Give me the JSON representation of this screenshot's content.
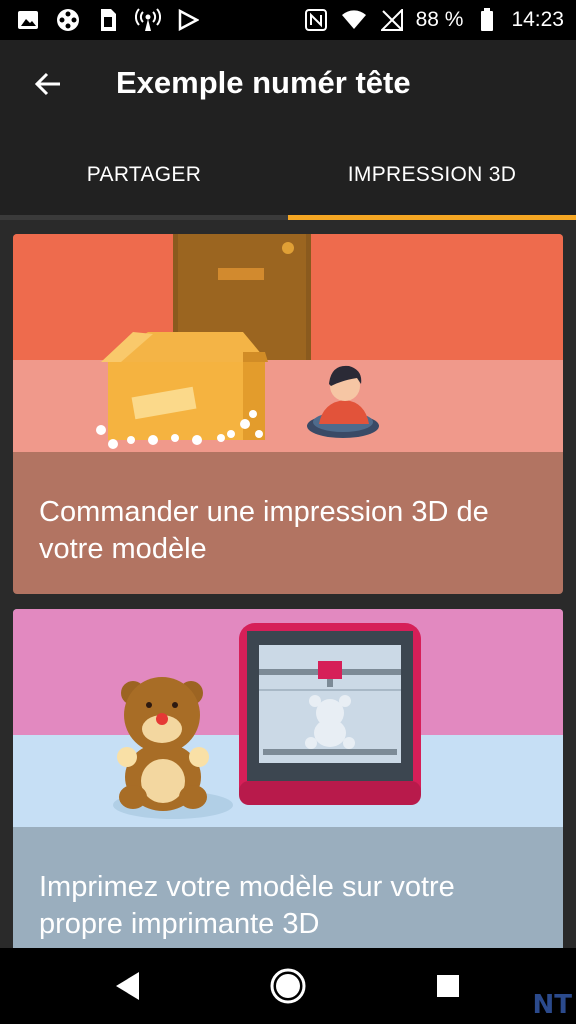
{
  "status": {
    "battery": "88 %",
    "time": "14:23"
  },
  "appbar": {
    "title": "Exemple numér tête"
  },
  "tabs": [
    {
      "label": "PARTAGER"
    },
    {
      "label": "IMPRESSION 3D"
    }
  ],
  "cards": [
    {
      "text": "Commander une impression 3D de votre modèle"
    },
    {
      "text": "Imprimez votre modèle sur votre propre imprimante 3D"
    }
  ],
  "watermark": "NT",
  "colors": {
    "accent": "#f5a623",
    "card1_bg": "#b27462",
    "card2_bg": "#9aaebe"
  }
}
